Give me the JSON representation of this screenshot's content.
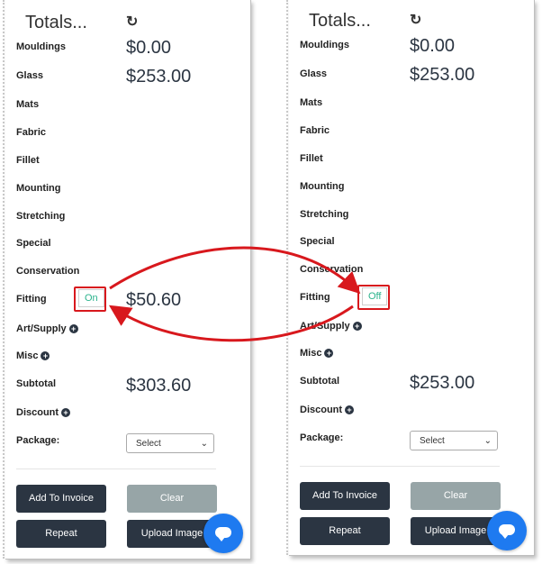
{
  "title": "Totals...",
  "labels": {
    "mouldings": "Mouldings",
    "glass": "Glass",
    "mats": "Mats",
    "fabric": "Fabric",
    "fillet": "Fillet",
    "mounting": "Mounting",
    "stretching": "Stretching",
    "special": "Special",
    "conservation": "Conservation",
    "fitting": "Fitting",
    "art_supply": "Art/Supply",
    "misc": "Misc",
    "subtotal": "Subtotal",
    "discount": "Discount",
    "package": "Package:"
  },
  "icons": {
    "refresh": "refresh-icon",
    "plus": "plus-circle-icon",
    "chat": "chat-bubble-icon"
  },
  "left_panel": {
    "mouldings_value": "$0.00",
    "glass_value": "$253.00",
    "fitting_toggle": "On",
    "fitting_value": "$50.60",
    "subtotal_value": "$303.60",
    "package_selected": "Select"
  },
  "right_panel": {
    "mouldings_value": "$0.00",
    "glass_value": "$253.00",
    "fitting_toggle": "Off",
    "subtotal_value": "$253.00",
    "package_selected": "Select"
  },
  "buttons": {
    "add_to_invoice": "Add To Invoice",
    "clear": "Clear",
    "repeat": "Repeat",
    "upload_image": "Upload Image"
  },
  "colors": {
    "dark_button": "#2b3542",
    "clear_button": "#97a5a7",
    "toggle_text": "#2bb38c",
    "annotation": "#d8181d",
    "chat_button": "#1e7af0"
  }
}
